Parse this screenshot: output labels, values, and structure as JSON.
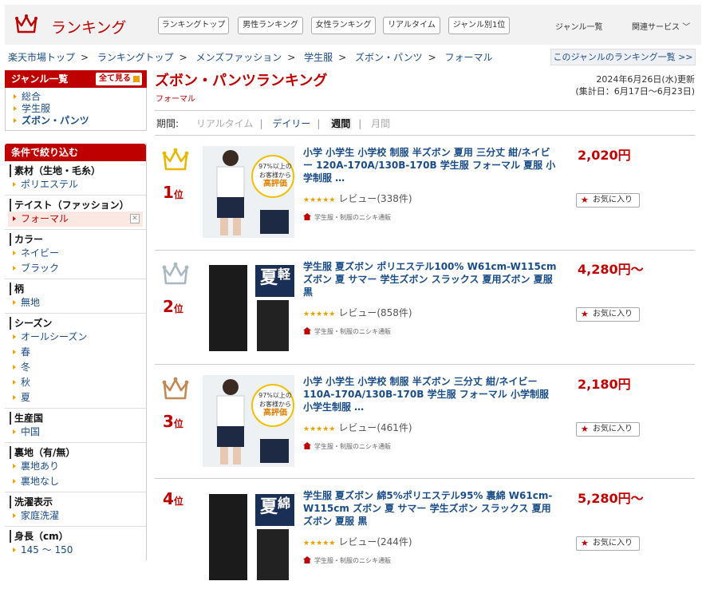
{
  "header": {
    "logo": "ランキング",
    "tabs": [
      "ランキングトップ",
      "男性ランキング",
      "女性ランキング",
      "リアルタイム",
      "ジャンル別1位"
    ],
    "genre_list": "ジャンル一覧",
    "related": "関連サービス"
  },
  "breadcrumb": [
    "楽天市場トップ",
    "ランキングトップ",
    "メンズファッション",
    "学生服",
    "ズボン・パンツ",
    "フォーマル"
  ],
  "genre_ranking_link": "このジャンルのランキング一覧 >>",
  "genre_box": {
    "title": "ジャンル一覧",
    "all": "全て見る",
    "items": [
      "総合",
      "学生服",
      "ズボン・パンツ"
    ]
  },
  "filter": {
    "title": "条件で絞り込む",
    "groups": [
      {
        "title": "素材（生地・毛糸）",
        "items": [
          "ポリエステル"
        ]
      },
      {
        "title": "テイスト（ファッション）",
        "items": [
          "フォーマル"
        ]
      },
      {
        "title": "カラー",
        "items": [
          "ネイビー",
          "ブラック"
        ]
      },
      {
        "title": "柄",
        "items": [
          "無地"
        ]
      },
      {
        "title": "シーズン",
        "items": [
          "オールシーズン",
          "春",
          "冬",
          "秋",
          "夏"
        ]
      },
      {
        "title": "生産国",
        "items": [
          "中国"
        ]
      },
      {
        "title": "裏地（有/無）",
        "items": [
          "裏地あり",
          "裏地なし"
        ]
      },
      {
        "title": "洗濯表示",
        "items": [
          "家庭洗濯"
        ]
      },
      {
        "title": "身長（cm）",
        "items": [
          "145 ～ 150"
        ]
      }
    ]
  },
  "page": {
    "title": "ズボン・パンツランキング",
    "subtitle": "フォーマル",
    "updated": "2024年6月26日(水)更新",
    "period_range": "(集計日：6月17日～6月23日)"
  },
  "period": {
    "label": "期間:",
    "options": [
      "リアルタイム",
      "デイリー",
      "週間",
      "月間"
    ]
  },
  "items": [
    {
      "rank": "1",
      "unit": "位",
      "name": "小学 小学生 小学校 制服 半ズボン 夏用 三分丈 紺/ネイビー 120A-170A/130B-170B 学生服 フォーマル 夏服 小学制服 …",
      "price": "2,020円",
      "reviews": "レビュー(338件)",
      "shop": "学生服・制服のニシキ通販",
      "fav": "お気に入り",
      "stars": "★★★★★"
    },
    {
      "rank": "2",
      "unit": "位",
      "name": "学生服 夏ズボン ポリエステル100% W61cm-W115cm ズボン 夏 サマー 学生ズボン スラックス 夏用ズボン 夏服 黒",
      "price": "4,280円～",
      "reviews": "レビュー(858件)",
      "shop": "学生服・制服のニシキ通販",
      "fav": "お気に入り",
      "stars": "★★★★★"
    },
    {
      "rank": "3",
      "unit": "位",
      "name": "小学 小学生 小学校 制服 半ズボン 三分丈 紺/ネイビー 110A-170A/130B-170B 学生服 フォーマル 小学制服 小学生制服 …",
      "price": "2,180円",
      "reviews": "レビュー(461件)",
      "shop": "学生服・制服のニシキ通販",
      "fav": "お気に入り",
      "stars": "★★★★★"
    },
    {
      "rank": "4",
      "unit": "位",
      "name": "学生服 夏ズボン 綿5%ポリエステル95% 裏綿 W61cm-W115cm ズボン 夏 サマー 学生ズボン スラックス 夏用ズボン 夏服 黒",
      "price": "5,280円～",
      "reviews": "レビュー(244件)",
      "shop": "学生服・制服のニシキ通販",
      "fav": "お気に入り",
      "stars": "★★★★★"
    }
  ],
  "thumbs": {
    "badge1": "97%以上の",
    "badge2": "お客様から",
    "badge3": "高評価",
    "kanji2": "夏",
    "kanji2b": "軽",
    "kanji4": "夏",
    "kanji4b": "綿"
  },
  "colors": {
    "brand": "#bf0000",
    "link": "#1a4d88",
    "gold": "#e8b800",
    "silver": "#aab8c4",
    "bronze": "#c08a55"
  }
}
